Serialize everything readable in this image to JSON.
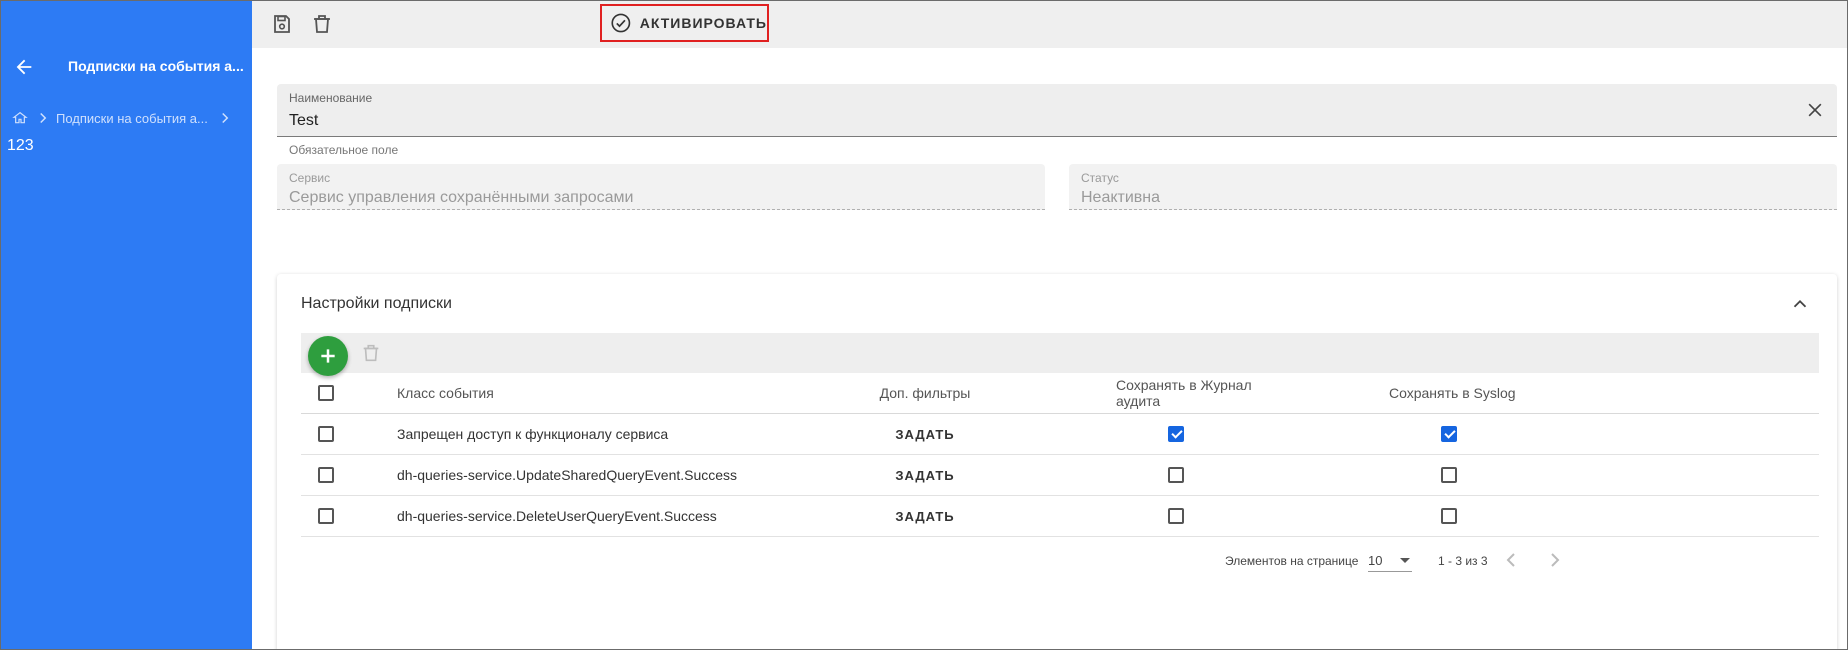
{
  "sidebar": {
    "title": "Подписки на события а...",
    "breadcrumb": "Подписки на события а...",
    "extra_text": "123"
  },
  "toolbar": {
    "activate_label": "АКТИВИРОВАТЬ"
  },
  "form": {
    "name": {
      "label": "Наименование",
      "value": "Test",
      "hint": "Обязательное поле"
    },
    "service": {
      "label": "Сервис",
      "value": "Сервис управления сохранёнными запросами"
    },
    "status": {
      "label": "Статус",
      "value": "Неактивна"
    }
  },
  "card": {
    "title": "Настройки подписки",
    "columns": [
      "Класс события",
      "Доп. фильтры",
      "Сохранять в Журнал аудита",
      "Сохранять в Syslog"
    ],
    "rows": [
      {
        "event": "Запрещен доступ к функционалу сервиса",
        "filter_label": "ЗАДАТЬ",
        "audit": true,
        "syslog": true
      },
      {
        "event": "dh-queries-service.UpdateSharedQueryEvent.Success",
        "filter_label": "ЗАДАТЬ",
        "audit": false,
        "syslog": false
      },
      {
        "event": "dh-queries-service.DeleteUserQueryEvent.Success",
        "filter_label": "ЗАДАТЬ",
        "audit": false,
        "syslog": false
      }
    ]
  },
  "pager": {
    "per_page_label": "Элементов на странице",
    "per_page": "10",
    "range": "1 - 3 из 3"
  },
  "colors": {
    "sidebar_bg": "#2d7bf4",
    "fab": "#2e9e3e",
    "checkbox": "#1565e0",
    "highlight": "#e02020"
  }
}
